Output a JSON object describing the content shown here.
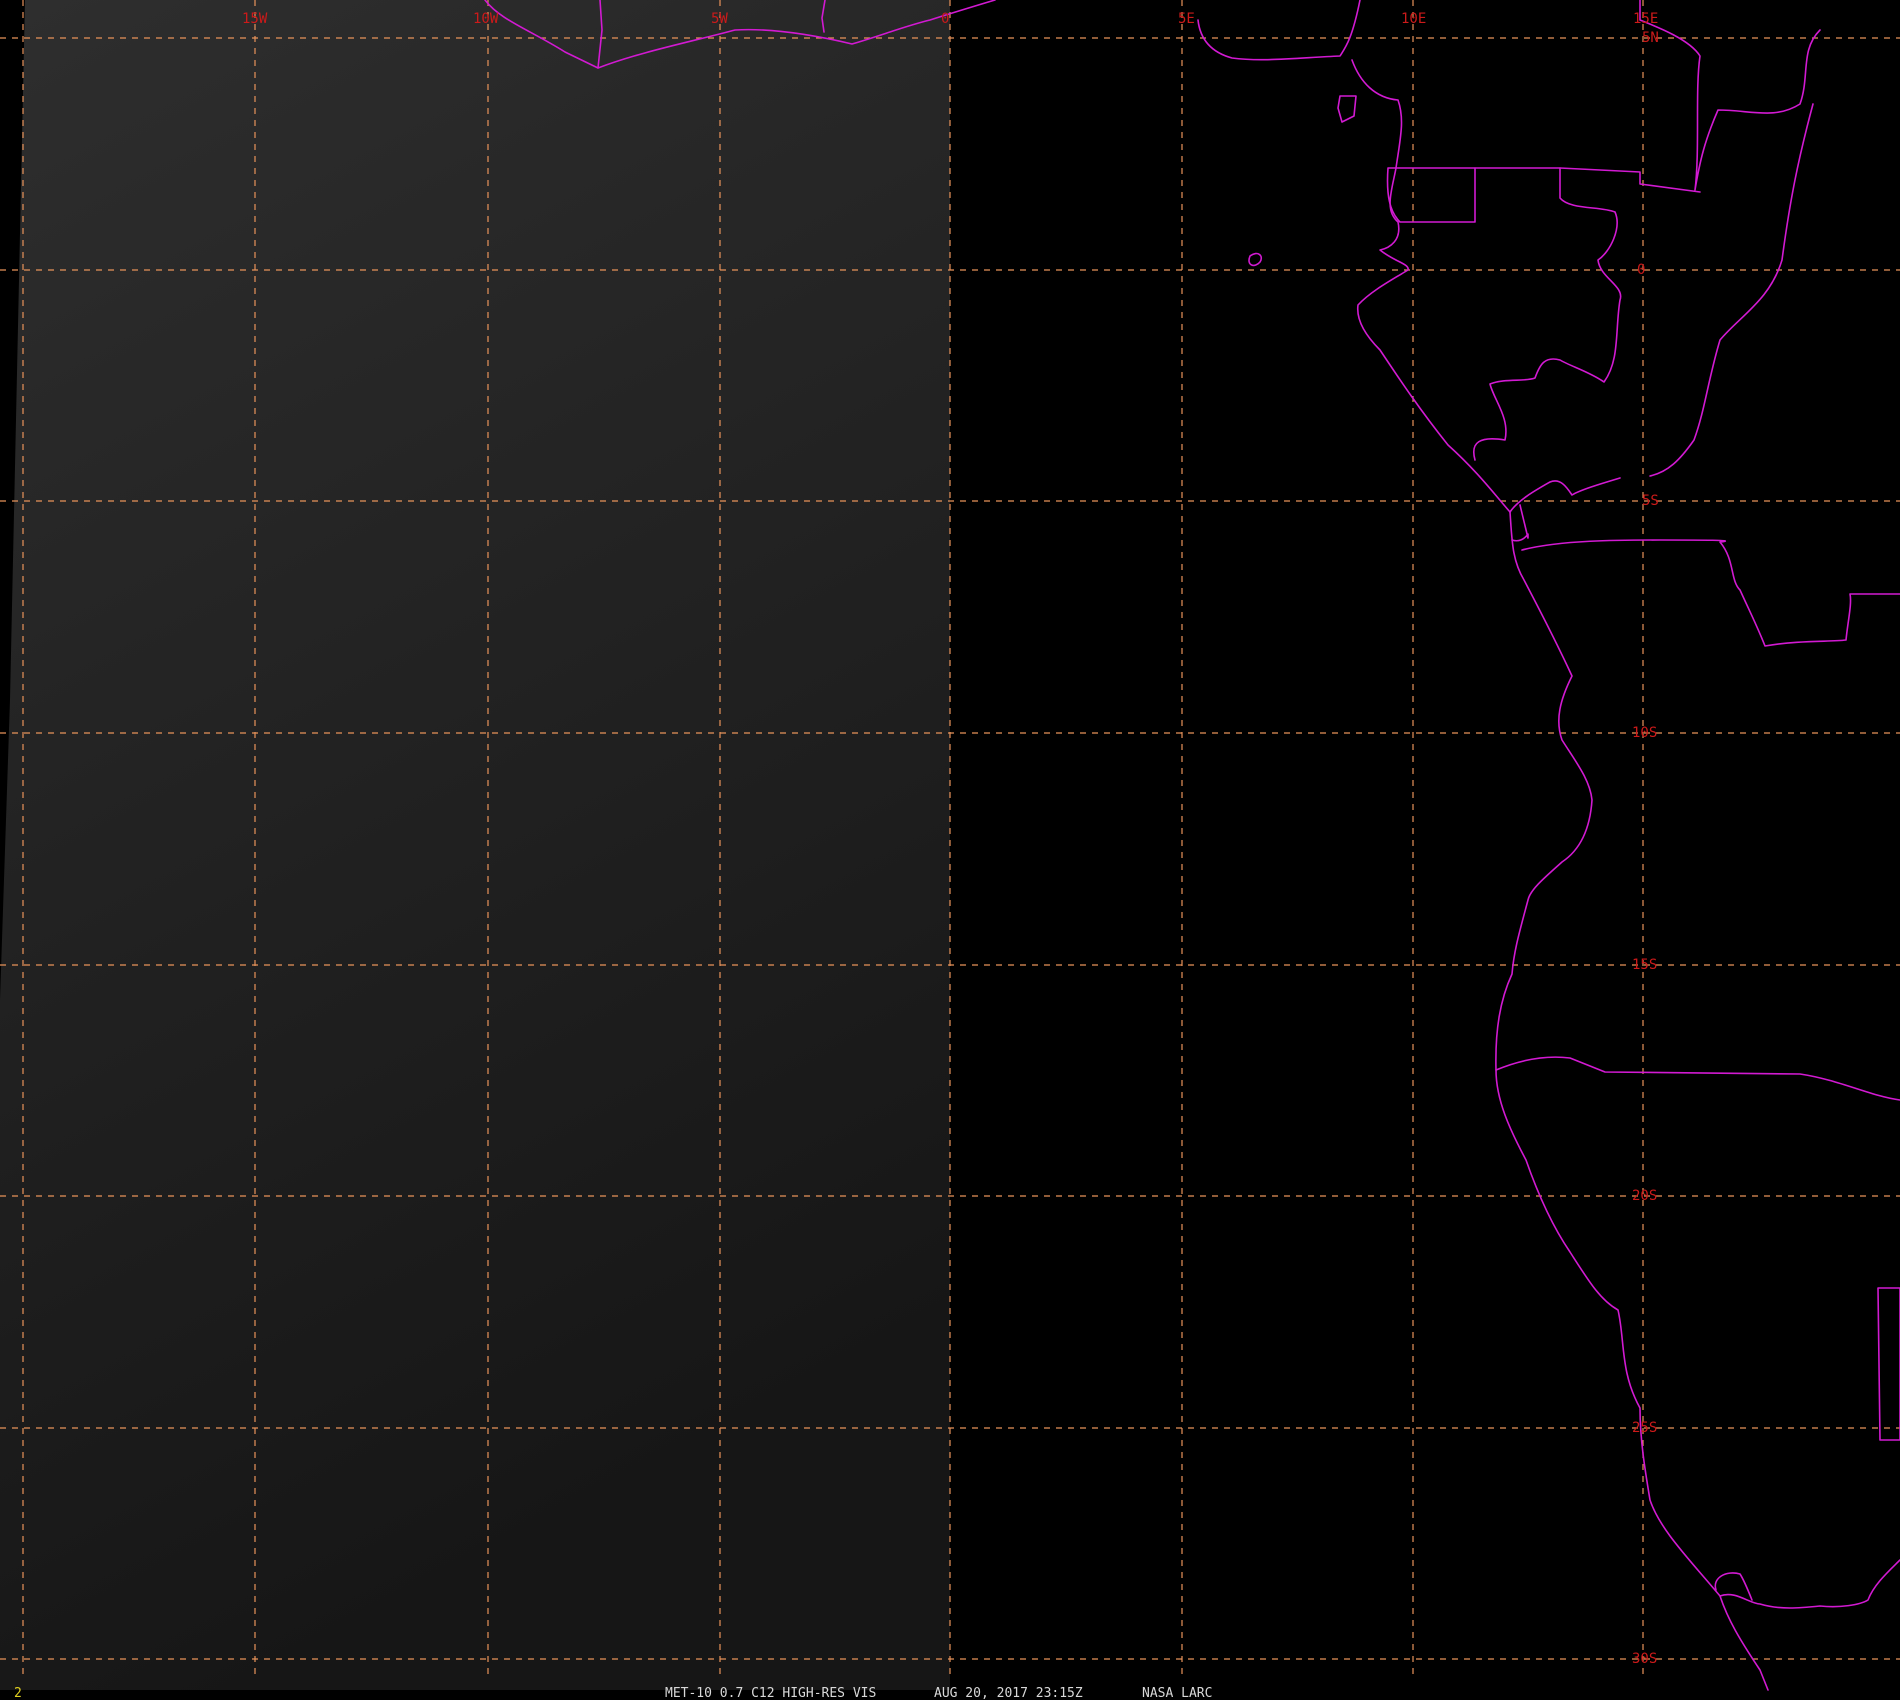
{
  "map": {
    "longitude_labels": [
      "15W",
      "10W",
      "5W",
      "0",
      "5E",
      "10E",
      "15E"
    ],
    "latitude_labels": [
      "5N",
      "0",
      "5S",
      "10S",
      "15S",
      "20S",
      "25S",
      "30S"
    ],
    "colors": {
      "background": "#000000",
      "night_imagery": "#1e1e1e",
      "graticule": "#e8935a",
      "borders": "#d21ad2",
      "grid_labels": "#cc1a1a",
      "status_text": "#d8d8d8",
      "frame_number": "#e0d020"
    }
  },
  "status_bar": {
    "frame_number": "2",
    "product": "MET-10 0.7 C12 HIGH-RES VIS",
    "datetime": "AUG 20, 2017 23:15Z",
    "source": "NASA LARC"
  }
}
